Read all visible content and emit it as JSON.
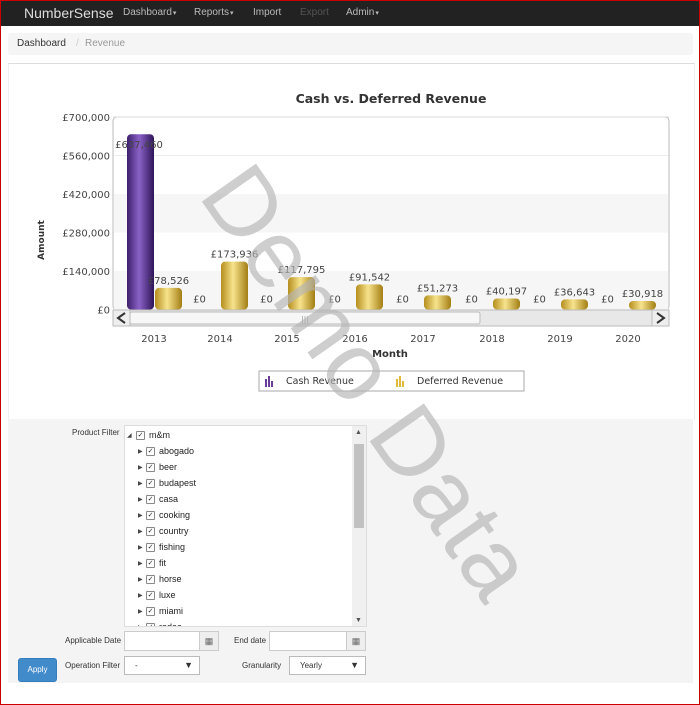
{
  "nav": {
    "brand": "NumberSense",
    "items": [
      {
        "label": "Dashboard",
        "dropdown": true,
        "disabled": false
      },
      {
        "label": "Reports",
        "dropdown": true,
        "disabled": false
      },
      {
        "label": "Import",
        "dropdown": false,
        "disabled": false
      },
      {
        "label": "Export",
        "dropdown": false,
        "disabled": true
      },
      {
        "label": "Admin",
        "dropdown": true,
        "disabled": false
      }
    ]
  },
  "breadcrumb": {
    "home": "Dashboard",
    "current": "Revenue"
  },
  "chart_data": {
    "type": "bar",
    "title": "Cash vs. Deferred Revenue",
    "xlabel": "Month",
    "ylabel": "Amount",
    "categories": [
      "2013",
      "2014",
      "2015",
      "2016",
      "2017",
      "2018",
      "2019",
      "2020"
    ],
    "ylim": [
      0,
      700000
    ],
    "yticks": [
      "£0",
      "£140,000",
      "£280,000",
      "£420,000",
      "£560,000",
      "£700,000"
    ],
    "series": [
      {
        "name": "Cash Revenue",
        "color": "#6a3d9a",
        "values": [
          637460,
          0,
          0,
          0,
          0,
          0,
          0,
          0
        ],
        "labels": [
          "£637,460",
          "£0",
          "£0",
          "£0",
          "£0",
          "£0",
          "£0",
          "£0"
        ]
      },
      {
        "name": "Deferred Revenue",
        "color": "#e8c34a",
        "values": [
          78526,
          173936,
          117795,
          91542,
          51273,
          40197,
          36643,
          30918
        ],
        "labels": [
          "£78,526",
          "£173,936",
          "£117,795",
          "£91,542",
          "£51,273",
          "£40,197",
          "£36,643",
          "£30,918"
        ]
      }
    ],
    "grid": true,
    "legend": "bottom"
  },
  "filters": {
    "product_label": "Product Filter",
    "tree_root": "m&m",
    "tree_items": [
      "abogado",
      "beer",
      "budapest",
      "casa",
      "cooking",
      "country",
      "fishing",
      "fit",
      "horse",
      "luxe",
      "miami",
      "rodeo"
    ],
    "applicable_date_label": "Applicable Date",
    "end_date_label": "End date",
    "operation_label": "Operation Filter",
    "operation_value": "-",
    "granularity_label": "Granularity",
    "granularity_value": "Yearly",
    "apply_label": "Apply"
  },
  "watermark": "Demo Data"
}
